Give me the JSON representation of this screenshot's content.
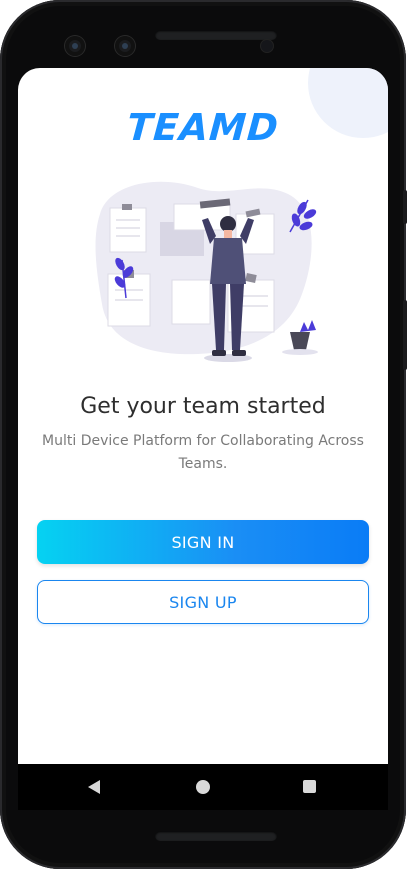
{
  "app": {
    "logo_text": "TEAMD"
  },
  "onboarding": {
    "headline": "Get your team started",
    "subtitle": "Multi Device Platform for Collaborating Across Teams.",
    "illustration_name": "team-board-illustration"
  },
  "actions": {
    "sign_in_label": "SIGN IN",
    "sign_up_label": "SIGN UP"
  },
  "navigation_bar": {
    "icons": [
      "back-icon",
      "home-icon",
      "recents-icon"
    ]
  },
  "colors": {
    "brand_blue": "#1a8fff",
    "gradient_start": "#05d2f2",
    "gradient_end": "#0a7cf6",
    "outline_blue": "#1a86ef",
    "headline_text": "#2e2e2e",
    "subtitle_text": "#7a7a7a"
  }
}
